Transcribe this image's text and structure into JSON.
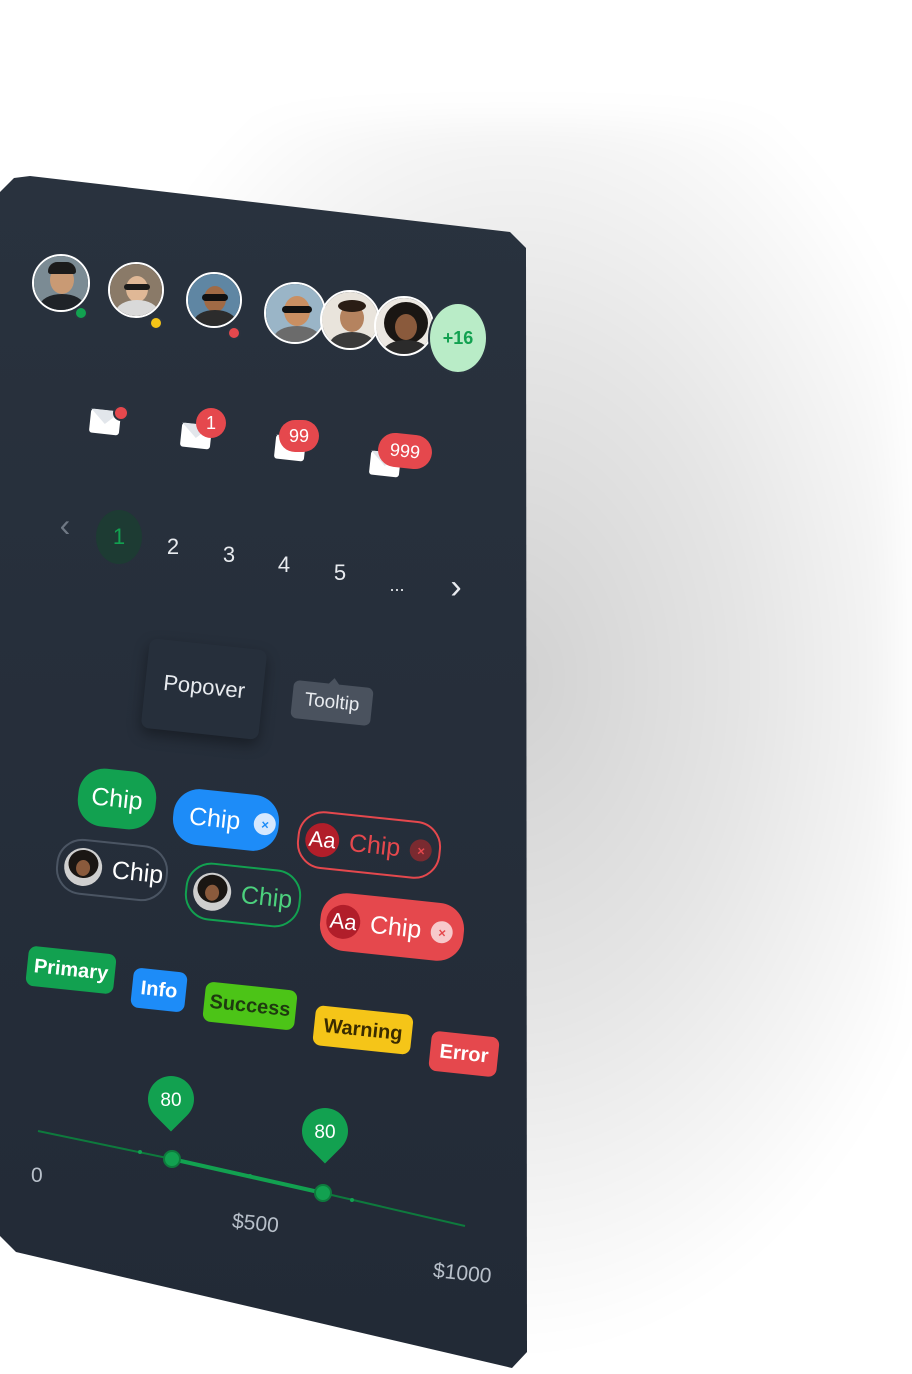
{
  "colors": {
    "panel": "#252d39",
    "primary": "#12a150",
    "info": "#1d8cf8",
    "success": "#4cc417",
    "warning": "#f5c518",
    "error": "#e5484d",
    "more_bg": "#b9ecc7",
    "more_text": "#12a150"
  },
  "avatars": {
    "single": [
      {
        "status": "online",
        "status_color": "#12a150"
      },
      {
        "status": "away",
        "status_color": "#f5c518"
      },
      {
        "status": "busy",
        "status_color": "#e5484d"
      }
    ],
    "group_more": "+16"
  },
  "notifications": [
    {
      "icon": "envelope-icon",
      "badge": ""
    },
    {
      "icon": "envelope-icon",
      "badge": "1"
    },
    {
      "icon": "envelope-icon",
      "badge": "99"
    },
    {
      "icon": "envelope-icon",
      "badge": "999"
    }
  ],
  "pagination": {
    "prev": "‹",
    "pages": [
      "1",
      "2",
      "3",
      "4",
      "5"
    ],
    "ellipsis": "...",
    "next": "›",
    "current": "1"
  },
  "overlays": {
    "popover": "Popover",
    "tooltip": "Tooltip"
  },
  "chips": {
    "label": "Chip",
    "avatar_text": "Aa",
    "close": "×"
  },
  "tags": [
    "Primary",
    "Info",
    "Success",
    "Warning",
    "Error"
  ],
  "slider": {
    "min_label": "0",
    "mid_label": "$500",
    "max_label": "$1000",
    "thumb_values": [
      "80",
      "80"
    ]
  }
}
